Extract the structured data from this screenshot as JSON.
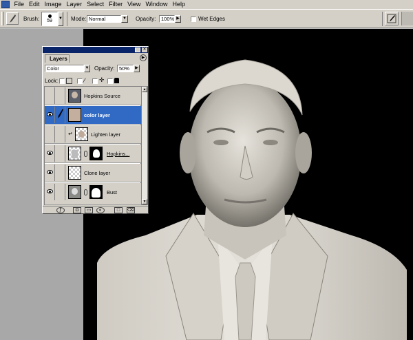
{
  "menu": [
    "File",
    "Edit",
    "Image",
    "Layer",
    "Select",
    "Filter",
    "View",
    "Window",
    "Help"
  ],
  "options_bar": {
    "brush_label": "Brush:",
    "brush_size": "59",
    "mode_label": "Mode:",
    "mode_value": "Normal",
    "opacity_label": "Opacity:",
    "opacity_value": "100%",
    "wet_edges_label": "Wet Edges"
  },
  "layers_palette": {
    "tab": "Layers",
    "blend_mode": "Color",
    "opacity_label": "Opacity:",
    "opacity_value": "50%",
    "lock_label": "Lock:",
    "layers": [
      {
        "name": "Hopkins Source",
        "visible": false,
        "selected": false
      },
      {
        "name": "color layer",
        "visible": true,
        "selected": true
      },
      {
        "name": "Lighten layer",
        "visible": false,
        "selected": false
      },
      {
        "name": "Hopkins...",
        "visible": true,
        "selected": false
      },
      {
        "name": "Clone layer",
        "visible": true,
        "selected": false
      },
      {
        "name": "Bust",
        "visible": true,
        "selected": false
      }
    ]
  },
  "colors": {
    "ui_gray": "#d4d0c8",
    "selection_blue": "#316ac5",
    "title_blue": "#0a246a",
    "canvas_black": "#000000",
    "marble": "#d8d4cc"
  }
}
